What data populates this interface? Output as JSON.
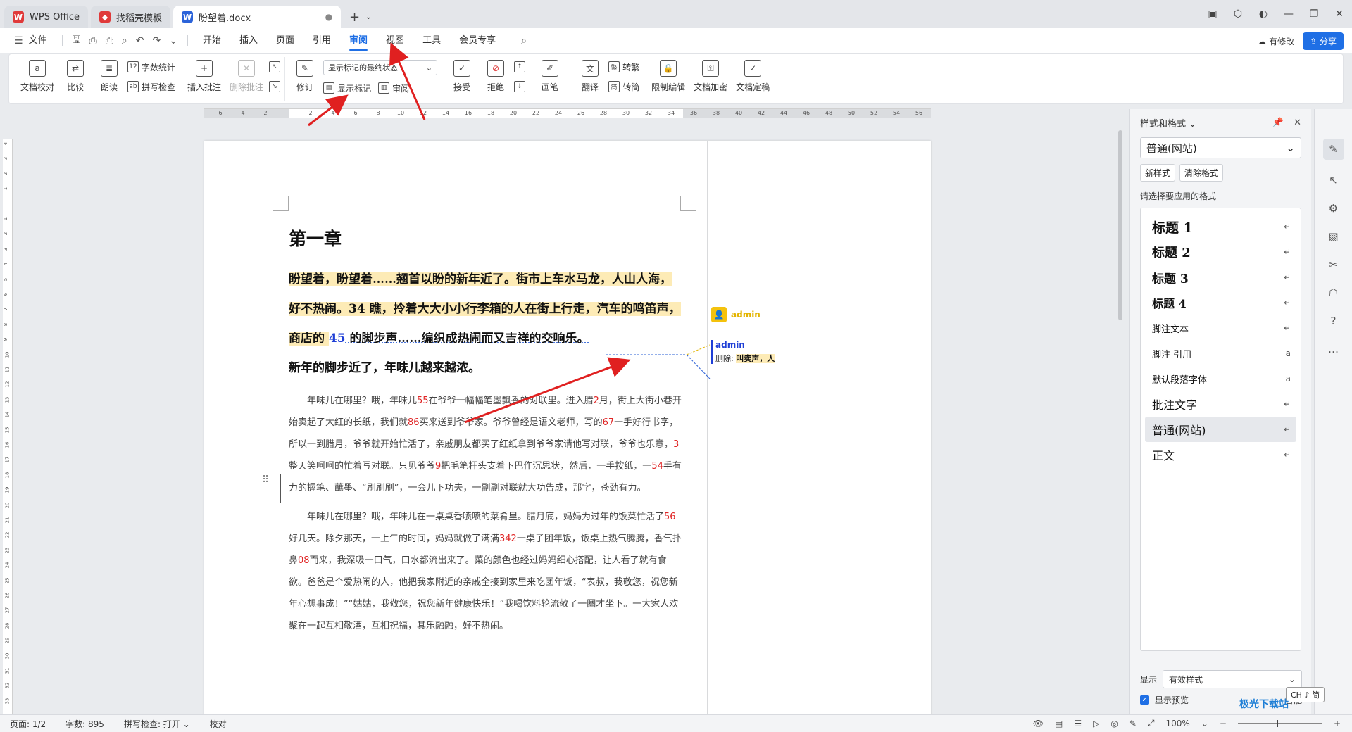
{
  "tabs": [
    {
      "label": "WPS Office",
      "icon": "wps-logo-icon",
      "color": "#e03a3a"
    },
    {
      "label": "找稻壳模板",
      "icon": "docer-icon",
      "color": "#e03a3a"
    },
    {
      "label": "盼望着.docx",
      "icon": "word-doc-icon",
      "color": "#2b63d9"
    }
  ],
  "menu": {
    "file_label": "文件",
    "items": [
      "开始",
      "插入",
      "页面",
      "引用",
      "审阅",
      "视图",
      "工具",
      "会员专享"
    ],
    "active": "审阅",
    "modified_label": "有修改",
    "share_label": "分享"
  },
  "ribbon": {
    "proofread": "文档校对",
    "compare": "比较",
    "read_aloud": "朗读",
    "word_count": "字数统计",
    "spell_check": "拼写检查",
    "insert_comment": "插入批注",
    "delete_comment": "删除批注",
    "revise": "修订",
    "markup_state_value": "显示标记的最终状态",
    "show_markup": "显示标记",
    "review": "审阅",
    "accept": "接受",
    "reject": "拒绝",
    "pen": "画笔",
    "translate": "翻译",
    "to_traditional": "转繁",
    "to_simplified": "转简",
    "restrict_edit": "限制编辑",
    "encrypt": "文档加密",
    "finalize": "文档定稿"
  },
  "ruler": {
    "h_ticks": [
      "6",
      "4",
      "2",
      "",
      "2",
      "4",
      "6",
      "8",
      "10",
      "12",
      "14",
      "16",
      "18",
      "20",
      "22",
      "24",
      "26",
      "28",
      "30",
      "32",
      "34",
      "36",
      "38",
      "40",
      "42",
      "44",
      "46",
      "48",
      "50",
      "52",
      "54",
      "56"
    ],
    "v_ticks": [
      "4",
      "3",
      "2",
      "1",
      "",
      "1",
      "2",
      "3",
      "4",
      "5",
      "6",
      "7",
      "8",
      "9",
      "10",
      "11",
      "12",
      "13",
      "14",
      "15",
      "16",
      "17",
      "18",
      "19",
      "20",
      "21",
      "22",
      "23",
      "24",
      "25",
      "26",
      "27",
      "28",
      "29",
      "30",
      "31",
      "32",
      "33"
    ]
  },
  "document": {
    "chapter_title": "第一章",
    "bold_para": {
      "part1": "盼望着，盼望着……翘首以盼的新年近了。街市上车水马龙，人山人海，好不热闹。34 瞧，拎着大大小小行李箱的人在街上行走，汽车的鸣笛声，商店的 ",
      "inserted": "45",
      "part2": " 的脚步声……编织成热闹而又吉祥的交响乐。",
      "part3": "新年的脚步近了，年味儿越来越浓。"
    },
    "para1": [
      "年味儿在哪里？哦，年味儿",
      "55",
      "在爷爷一幅幅笔墨飘香的对联里。进入腊",
      "2",
      "月，街上大街小巷开始卖起了大红的长纸，我们就",
      "86",
      "买来送到爷爷家。爷爷曾经是语文老师，写的",
      "67",
      "一手好行书字，所以一到腊月，爷爷就开始忙活了，亲戚朋友都买了红纸拿到爷爷家请他写对联，爷爷也乐意，",
      "3",
      "整天笑呵呵的忙着写对联。只见爷爷",
      "9",
      "把毛笔杆头支着下巴作沉思状，然后，一手按纸，一",
      "54",
      "手有力的握笔、蘸墨、“刷刷刷”，一会儿下功夫，一副副对联就大功告成，那字，苍劲有力。"
    ],
    "para2": [
      "年味儿在哪里？哦，年味儿在一桌桌香喷喷的菜肴里。腊月底，妈妈为过年的饭菜忙活了",
      "56",
      "好几天。除夕那天，一上午的时间，妈妈就做了满满",
      "342",
      "一桌子团年饭，饭桌上热气腾腾，香气扑鼻",
      "08",
      "而来，我深吸一口气，口水都流出来了。菜的颜色也经过妈妈细心搭配，让人看了就有食欲。爸爸是个爱热闹的人，他把我家附近的亲戚全接到家里来吃团年饭，“表叔，我敬您，祝您新年心想事成！”“姑姑，我敬您，祝您新年健康快乐！”我喝饮料轮流敬了一圈才坐下。一大家人欢聚在一起互相敬酒，互相祝福，其乐融融，好不热闹。"
    ],
    "comment1_author": "admin",
    "comment2_author": "admin",
    "comment2_prefix": "删除:",
    "comment2_text": "叫卖声，人"
  },
  "style_panel": {
    "title": "样式和格式",
    "current_style": "普通(网站)",
    "new_style": "新样式",
    "clear_format": "清除格式",
    "hint": "请选择要应用的格式",
    "styles": [
      "标题 1",
      "标题 2",
      "标题 3",
      "标题 4",
      "脚注文本",
      "脚注 引用",
      "默认段落字体",
      "批注文字",
      "普通(网站)",
      "正文"
    ],
    "show_label": "显示",
    "show_value": "有效样式",
    "preview_label": "显示预览",
    "smart_label": "智能"
  },
  "status": {
    "page": "页面: 1/2",
    "words": "字数: 895",
    "spell": "拼写检查: 打开",
    "proof": "校对",
    "zoom": "100%"
  },
  "ime": "CH ♪ 简",
  "watermark": "极光下载站",
  "colors": {
    "accent": "#1f6fe5",
    "highlight": "#fdebb6",
    "number_red": "#e02424",
    "arrow_red": "#e02020"
  }
}
